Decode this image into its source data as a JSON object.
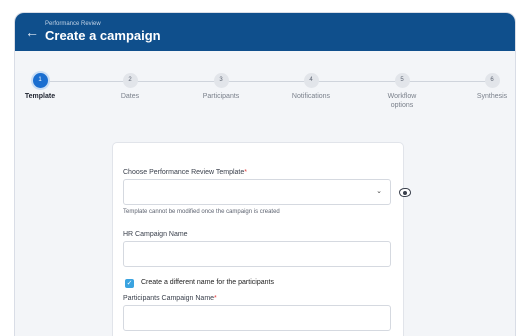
{
  "header": {
    "breadcrumb": "Performance Review",
    "title": "Create a campaign",
    "back_icon": "arrow-left-icon"
  },
  "stepper": {
    "steps": [
      {
        "number": "1",
        "label": "Template",
        "active": true
      },
      {
        "number": "2",
        "label": "Dates",
        "active": false
      },
      {
        "number": "3",
        "label": "Participants",
        "active": false
      },
      {
        "number": "4",
        "label": "Notifications",
        "active": false
      },
      {
        "number": "5",
        "label": "Workflow options",
        "active": false
      },
      {
        "number": "6",
        "label": "Synthesis",
        "active": false
      }
    ]
  },
  "form": {
    "template_label": "Choose Performance Review Template",
    "required_mark": "*",
    "template_value": "",
    "template_hint": "Template cannot be modified once the campaign is created",
    "hr_name_label": "HR Campaign Name",
    "hr_name_value": "",
    "different_name_label": "Create a different name for the participants",
    "different_name_checked": true,
    "participants_name_label": "Participants Campaign Name",
    "participants_name_value": ""
  },
  "colors": {
    "header_bg": "#0f4f8c",
    "accent": "#1a6ed0",
    "checkbox": "#3aa3e0",
    "required": "#e23b3b"
  }
}
